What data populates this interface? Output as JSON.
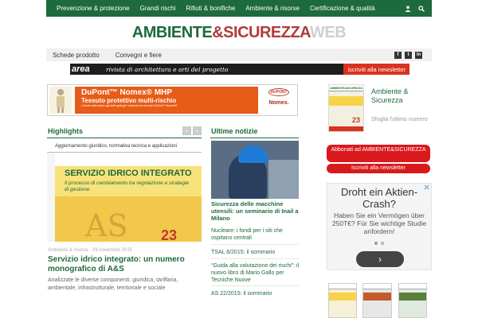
{
  "topnav": {
    "items": [
      "Prevenzione & protezione",
      "Grandi rischi",
      "Rifiuti & bonifiche",
      "Ambiente & risorse",
      "Certificazione & qualità"
    ],
    "icons": [
      "user-icon",
      "search-icon"
    ]
  },
  "logo": {
    "part1": "AMBIENTE",
    "part2": "&SICUREZZA",
    "part3": "WEB"
  },
  "subnav": {
    "items": [
      "Schede prodotto",
      "Convegni e fiere"
    ],
    "social": [
      "f",
      "t",
      "in"
    ]
  },
  "area_banner": {
    "logo": "area",
    "tagline": "rivista di architettura e arti del progetto",
    "cta": "iscriviti alla newsletter"
  },
  "dupont_ad": {
    "line1": "DuPont™ Nomex® MHP",
    "line2": "Tessuto protettivo multi-rischio",
    "line3": "L'ideale alternativa agli abiti ignifughi realizzati con tessuti DuPont™ Nomex®",
    "brand": "DUPONT",
    "product": "Nomex."
  },
  "sidebar": {
    "magazine_title": "Ambiente & Sicurezza",
    "magazine_link": "Sfoglia l'ultimo numero",
    "cover_header": "AMBIENTE&SICUREZZA",
    "cover_number": "23",
    "subscribe_button": "Abbonati ad AMBIENTE&SICUREZZA",
    "newsletter_button": "Iscriviti alla newsletter"
  },
  "aktien_ad": {
    "headline": "Droht ein Aktien-Crash?",
    "body": "Haben Sie ein Vermögen über 250T€? Für Sie wichtige Studie anfordern!",
    "arrow": "›"
  },
  "highlights": {
    "title": "Highlights",
    "prev": "‹",
    "next": "›",
    "image_strip": "Aggiornamento giuridico, normativa tecnica e applicazioni",
    "image_title": "SERVIZIO IDRICO INTEGRATO",
    "image_subtitle": "Il processo di cambiamento tra regolazione e strategie di gestione",
    "image_logo": "AS",
    "image_number": "23",
    "meta": "Ambiente & risorse · 28 novembre 2015",
    "headline": "Servizio idrico integrato: un numero monografico di A&S",
    "excerpt": "Analizzate le diverse componenti: giuridica, tariffaria, ambientale, infrastrutturale, territoriale e sociale"
  },
  "ultime_notizie": {
    "title": "Ultime notizie",
    "headline": "Sicurezza delle macchine utensili: un seminario di Inail a Milano",
    "items": [
      "Nucleare: i fondi per i siti che ospitano centrali",
      "TSAL 6/2015: il sommario",
      "“Guida alla valutazione dei rischi”: il nuovo libro di Mario Gallo per Tecniche Nuove",
      "AS 22/2015: il sommario"
    ]
  },
  "colors": {
    "brand_green": "#1d6a3c",
    "brand_red": "#d9191c",
    "ad_orange": "#e75c17"
  }
}
